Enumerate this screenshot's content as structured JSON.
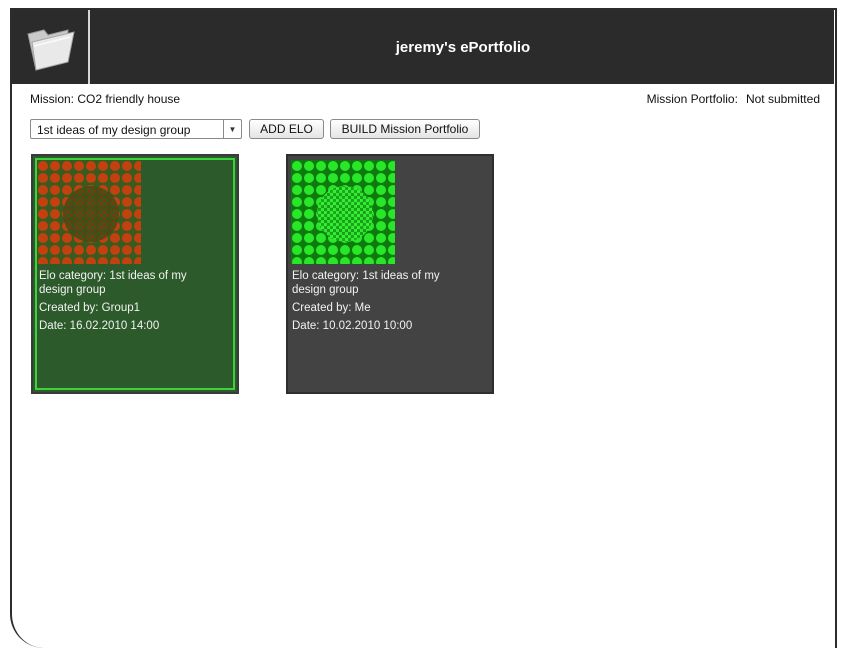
{
  "header": {
    "title": "jeremy's ePortfolio",
    "logo_icon": "folder-icon"
  },
  "mission": {
    "label": "Mission: CO2 friendly house",
    "portfolio_label": "Mission Portfolio:",
    "portfolio_status": "Not submitted"
  },
  "toolbar": {
    "category_select": "1st ideas of my design group",
    "add_elo_label": "ADD ELO",
    "build_label": "BUILD Mission Portfolio"
  },
  "elos": [
    {
      "category_line1": "Elo category: 1st ideas of my",
      "category_line2": "design group",
      "created_by": "Created by: Group1",
      "date": "Date: 16.02.2010 14:00",
      "selected": true,
      "thumb_colors": [
        "#b33a12",
        "#1e6b1e"
      ]
    },
    {
      "category_line1": "Elo category: 1st ideas of my",
      "category_line2": "design group",
      "created_by": "Created by: Me",
      "date": "Date: 10.02.2010 10:00",
      "selected": false,
      "thumb_colors": [
        "#22e022",
        "#0f8a0f"
      ]
    }
  ],
  "colors": {
    "header_bg": "#2b2b2b",
    "selected_border": "#3bd23b",
    "card_selected_bg": "#2d5a2a",
    "card_bg": "#434343"
  }
}
